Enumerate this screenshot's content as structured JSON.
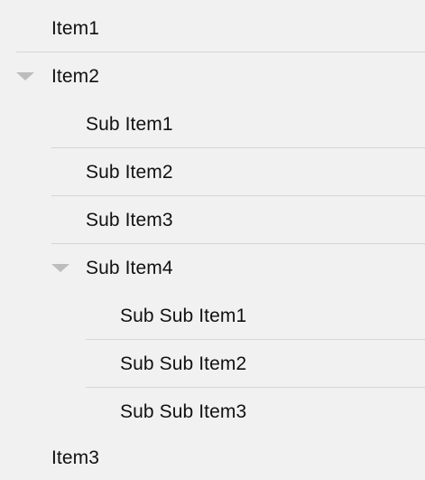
{
  "tree": {
    "item1": {
      "label": "Item1"
    },
    "item2": {
      "label": "Item2",
      "expanded": true,
      "expand_icon": "triangle-down-icon",
      "children": {
        "sub_item1": {
          "label": "Sub Item1"
        },
        "sub_item2": {
          "label": "Sub Item2"
        },
        "sub_item3": {
          "label": "Sub Item3"
        },
        "sub_item4": {
          "label": "Sub Item4",
          "expanded": true,
          "expand_icon": "triangle-down-icon",
          "children": {
            "sub_sub_item1": {
              "label": "Sub Sub Item1"
            },
            "sub_sub_item2": {
              "label": "Sub Sub Item2"
            },
            "sub_sub_item3": {
              "label": "Sub Sub Item3"
            }
          }
        }
      }
    },
    "item3": {
      "label": "Item3"
    }
  },
  "colors": {
    "background": "#f1f1f1",
    "text": "#111111",
    "divider": "#d5d5d5",
    "caret": "#bdbdbd"
  }
}
